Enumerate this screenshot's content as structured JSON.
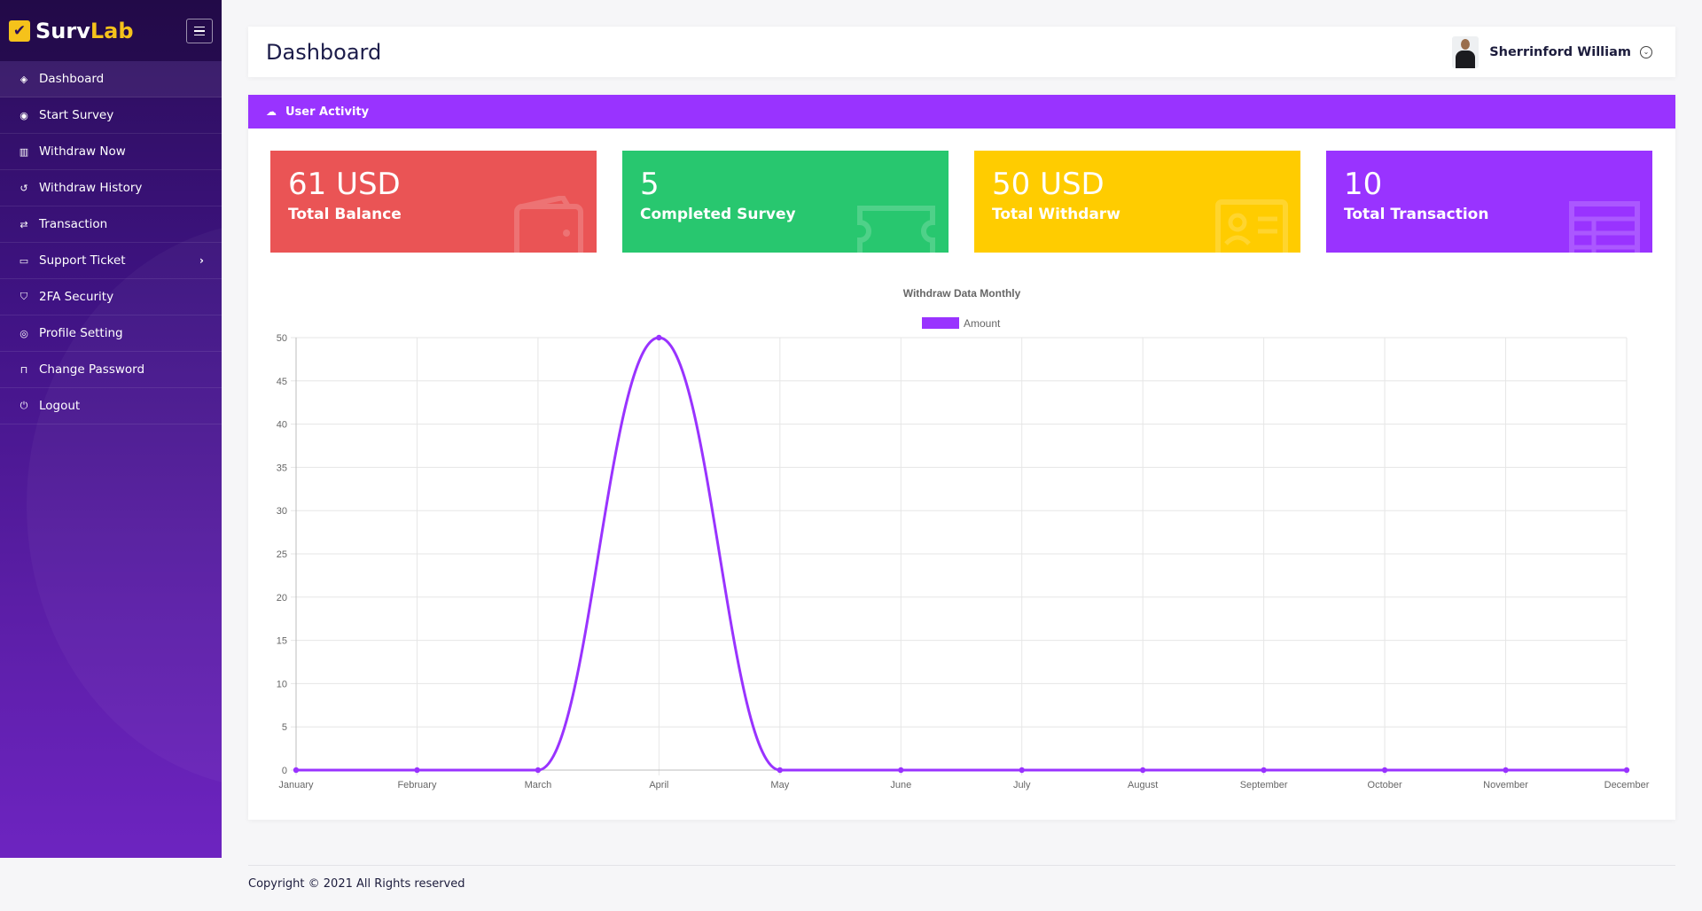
{
  "brand": {
    "name_part1": "Surv",
    "name_part2": "Lab",
    "logo_mark": "✔"
  },
  "sidebar": {
    "items": [
      {
        "label": "Dashboard",
        "icon": "layers-icon",
        "glyph": "◈"
      },
      {
        "label": "Start Survey",
        "icon": "play-circle-icon",
        "glyph": "◉"
      },
      {
        "label": "Withdraw Now",
        "icon": "bank-icon",
        "glyph": "▥"
      },
      {
        "label": "Withdraw History",
        "icon": "history-icon",
        "glyph": "↺"
      },
      {
        "label": "Transaction",
        "icon": "exchange-icon",
        "glyph": "⇄"
      },
      {
        "label": "Support Ticket",
        "icon": "ticket-icon",
        "glyph": "▭",
        "arrow": "›"
      },
      {
        "label": "2FA Security",
        "icon": "shield-icon",
        "glyph": "⛉"
      },
      {
        "label": "Profile Setting",
        "icon": "user-circle-icon",
        "glyph": "◎"
      },
      {
        "label": "Change Password",
        "icon": "lock-icon",
        "glyph": "⊓"
      },
      {
        "label": "Logout",
        "icon": "power-icon",
        "glyph": "⏻"
      }
    ]
  },
  "header": {
    "title": "Dashboard",
    "user_name": "Sherrinford William",
    "chevron": "⌄"
  },
  "panel": {
    "title": "User Activity",
    "icon_glyph": "☁"
  },
  "stats": [
    {
      "value": "61 USD",
      "label": "Total Balance",
      "color": "#ea5455",
      "icon": "wallet-icon"
    },
    {
      "value": "5",
      "label": "Completed Survey",
      "color": "#28c76f",
      "icon": "ticket-icon"
    },
    {
      "value": "50 USD",
      "label": "Total Withdarw",
      "color": "#ffcc00",
      "icon": "id-card-icon"
    },
    {
      "value": "10",
      "label": "Total Transaction",
      "color": "#9933ff",
      "icon": "table-icon"
    }
  ],
  "chart_data": {
    "type": "line",
    "title": "Withdraw Data Monthly",
    "categories": [
      "January",
      "February",
      "March",
      "April",
      "May",
      "June",
      "July",
      "August",
      "September",
      "October",
      "November",
      "December"
    ],
    "series": [
      {
        "name": "Amount",
        "values": [
          0,
          0,
          0,
          50,
          0,
          0,
          0,
          0,
          0,
          0,
          0,
          0
        ],
        "color": "#9933ff"
      }
    ],
    "ylim": [
      0,
      50
    ],
    "yticks": [
      0,
      5,
      10,
      15,
      20,
      25,
      30,
      35,
      40,
      45,
      50
    ],
    "grid": true,
    "legend": "top"
  },
  "footer": {
    "text": "Copyright © 2021 All Rights reserved"
  }
}
